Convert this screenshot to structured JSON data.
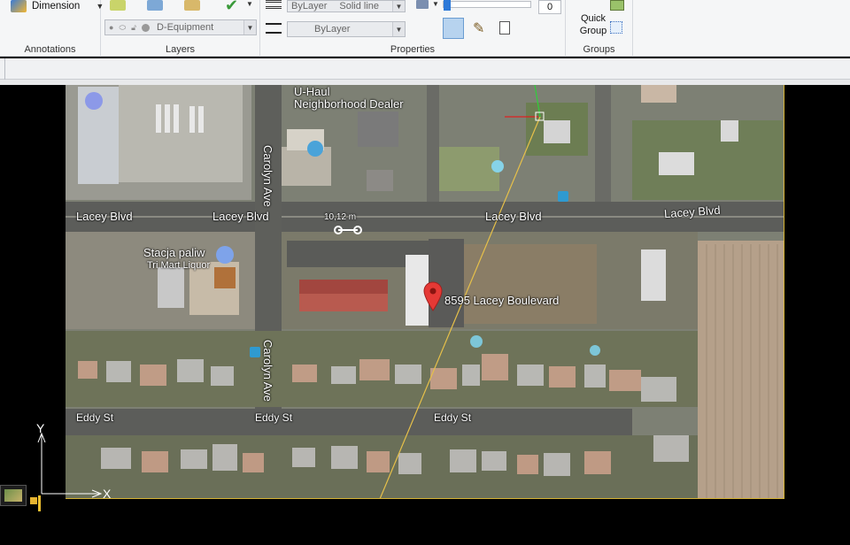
{
  "ribbon": {
    "annotations": {
      "dimension_label": "Dimension",
      "panel_title": "Annotations"
    },
    "layers": {
      "current_layer": "D-Equipment",
      "panel_title": "Layers"
    },
    "properties": {
      "color_value": "ByLayer",
      "linetype_value": "Solid line",
      "lineweight_value": "ByLayer",
      "transparency_value": "0",
      "panel_title": "Properties"
    },
    "groups": {
      "quick_group_line1": "Quick",
      "quick_group_line2": "Group",
      "panel_title": "Groups"
    }
  },
  "map": {
    "labels": {
      "uhaul_1": "U-Haul",
      "uhaul_2": "Neighborhood Dealer",
      "lacey_1": "Lacey Blvd",
      "lacey_2": "Lacey Blvd",
      "lacey_3": "Lacey Blvd",
      "lacey_4": "Lacey Blvd",
      "carolyn_1": "Carolyn Ave",
      "carolyn_2": "Carolyn Ave",
      "scale": "10,12 m",
      "stacja": "Stacja paliw",
      "trimart": "Tri Mart Liquor",
      "address": "8595 Lacey Boulevard",
      "eddy_1": "Eddy St",
      "eddy_2": "Eddy St",
      "eddy_3": "Eddy St"
    }
  },
  "ucs": {
    "x_label": "X",
    "y_label": "Y"
  },
  "colors": {
    "ribbon_bg": "#f5f6f7",
    "canvas_bg": "#000000",
    "frame": "#d4b233",
    "pin": "#e53935"
  }
}
